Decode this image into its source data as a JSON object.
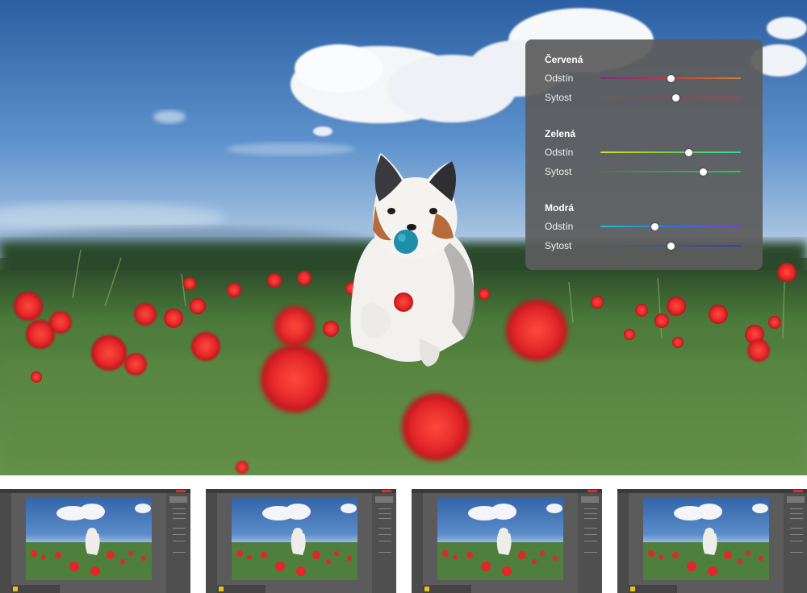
{
  "hsl_panel": {
    "groups": [
      {
        "title": "Červená",
        "rows": [
          {
            "label": "Odstín",
            "value": 0.5,
            "colors": [
              "#7a2a8a",
              "#c33a3a",
              "#d0802a"
            ]
          },
          {
            "label": "Sytost",
            "value": 0.54,
            "colors": [
              "#6e5a5a",
              "#a04040",
              "#d83030"
            ]
          }
        ]
      },
      {
        "title": "Zelená",
        "rows": [
          {
            "label": "Odstín",
            "value": 0.63,
            "colors": [
              "#d8e020",
              "#6fd040",
              "#2fd8a0"
            ]
          },
          {
            "label": "Sytost",
            "value": 0.73,
            "colors": [
              "#5a6e5a",
              "#40a040",
              "#20d040"
            ]
          }
        ]
      },
      {
        "title": "Modrá",
        "rows": [
          {
            "label": "Odstín",
            "value": 0.39,
            "colors": [
              "#20c0d0",
              "#3070e0",
              "#7a40d8"
            ]
          },
          {
            "label": "Sytost",
            "value": 0.5,
            "colors": [
              "#5a5a6e",
              "#4050a0",
              "#2040e0"
            ]
          }
        ]
      }
    ]
  },
  "thumbnails": [
    {
      "label": "thumbnail-1"
    },
    {
      "label": "thumbnail-2"
    },
    {
      "label": "thumbnail-3"
    },
    {
      "label": "thumbnail-4"
    }
  ],
  "colors": {
    "panel_bg": "#5c5c5c",
    "accent_red": "#e3262a"
  }
}
